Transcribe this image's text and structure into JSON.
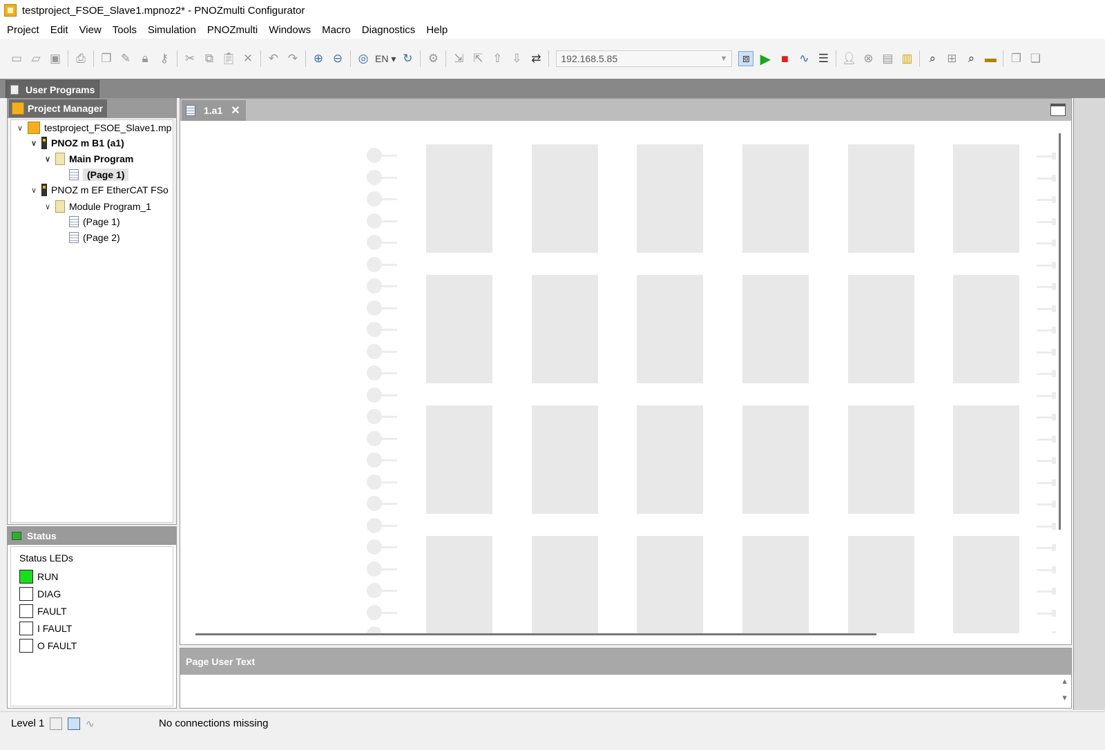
{
  "window": {
    "title": "testproject_FSOE_Slave1.mpnoz2* - PNOZmulti Configurator"
  },
  "menu": [
    "Project",
    "Edit",
    "View",
    "Tools",
    "Simulation",
    "PNOZmulti",
    "Windows",
    "Macro",
    "Diagnostics",
    "Help"
  ],
  "toolbar": {
    "ip_address": "192.168.5.85",
    "language": "EN"
  },
  "user_programs": {
    "tab_label": "User Programs"
  },
  "project_manager": {
    "title": "Project Manager",
    "tree": [
      {
        "label": "testproject_FSOE_Slave1.mp",
        "level": 0,
        "expanded": true,
        "bold": false,
        "icon": "project-icon"
      },
      {
        "label": "PNOZ m B1 (a1)",
        "level": 1,
        "expanded": true,
        "bold": true,
        "icon": "device-icon"
      },
      {
        "label": "Main Program",
        "level": 2,
        "expanded": true,
        "bold": true,
        "icon": "program-icon"
      },
      {
        "label": "(Page 1)",
        "level": 3,
        "bold": true,
        "selected": true,
        "icon": "page-icon"
      },
      {
        "label": "PNOZ m EF EtherCAT FSo",
        "level": 1,
        "expanded": true,
        "bold": false,
        "icon": "device-icon"
      },
      {
        "label": "Module Program_1",
        "level": 2,
        "expanded": true,
        "bold": false,
        "icon": "program-icon"
      },
      {
        "label": "(Page 1)",
        "level": 3,
        "bold": false,
        "icon": "page-icon"
      },
      {
        "label": "(Page 2)",
        "level": 3,
        "bold": false,
        "icon": "page-icon"
      }
    ]
  },
  "status": {
    "title": "Status",
    "section_label": "Status LEDs",
    "leds": [
      {
        "label": "RUN",
        "on": true,
        "color": "#18e018"
      },
      {
        "label": "DIAG",
        "on": false
      },
      {
        "label": "FAULT",
        "on": false
      },
      {
        "label": "I FAULT",
        "on": false
      },
      {
        "label": "O FAULT",
        "on": false
      }
    ]
  },
  "editor": {
    "tab_label": "1.a1"
  },
  "page_user_text": {
    "title": "Page User Text"
  },
  "statusbar": {
    "level": "Level 1",
    "message": "No connections missing"
  }
}
